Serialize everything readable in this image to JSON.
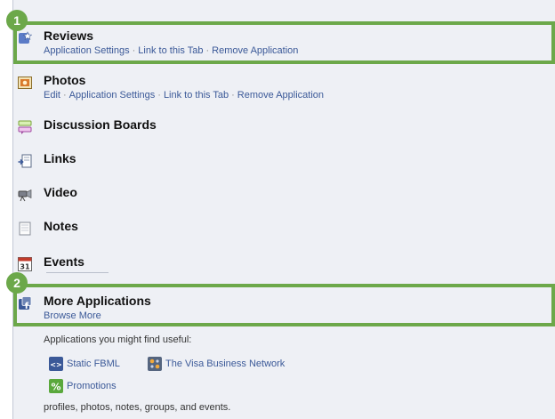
{
  "applications": [
    {
      "title": "Reviews",
      "icon": "reviews-icon",
      "links": [
        "Application Settings",
        "Link to this Tab",
        "Remove Application"
      ]
    },
    {
      "title": "Photos",
      "icon": "photos-icon",
      "links": [
        "Edit",
        "Application Settings",
        "Link to this Tab",
        "Remove Application"
      ]
    },
    {
      "title": "Discussion Boards",
      "icon": "discussion-boards-icon"
    },
    {
      "title": "Links",
      "icon": "links-icon"
    },
    {
      "title": "Video",
      "icon": "video-camera-icon"
    },
    {
      "title": "Notes",
      "icon": "notes-icon"
    },
    {
      "title": "Events",
      "icon": "calendar-icon",
      "icon_text": "31"
    }
  ],
  "more_applications": {
    "title": "More Applications",
    "link": "Browse More",
    "suggest_text": "Applications you might find useful:",
    "suggested": [
      {
        "label": "Static FBML",
        "icon": "fbml-code-icon",
        "icon_text": "<>"
      },
      {
        "label": "The Visa Business Network",
        "icon": "visa-network-icon"
      },
      {
        "label": "Promotions",
        "icon": "percent-icon",
        "icon_text": "%"
      }
    ],
    "footer_text": "profiles, photos, notes, groups, and events."
  },
  "callouts": [
    "1",
    "2"
  ],
  "colors": {
    "highlight": "#6ca84a",
    "link": "#3b5998",
    "panel": "#eef0f5"
  }
}
